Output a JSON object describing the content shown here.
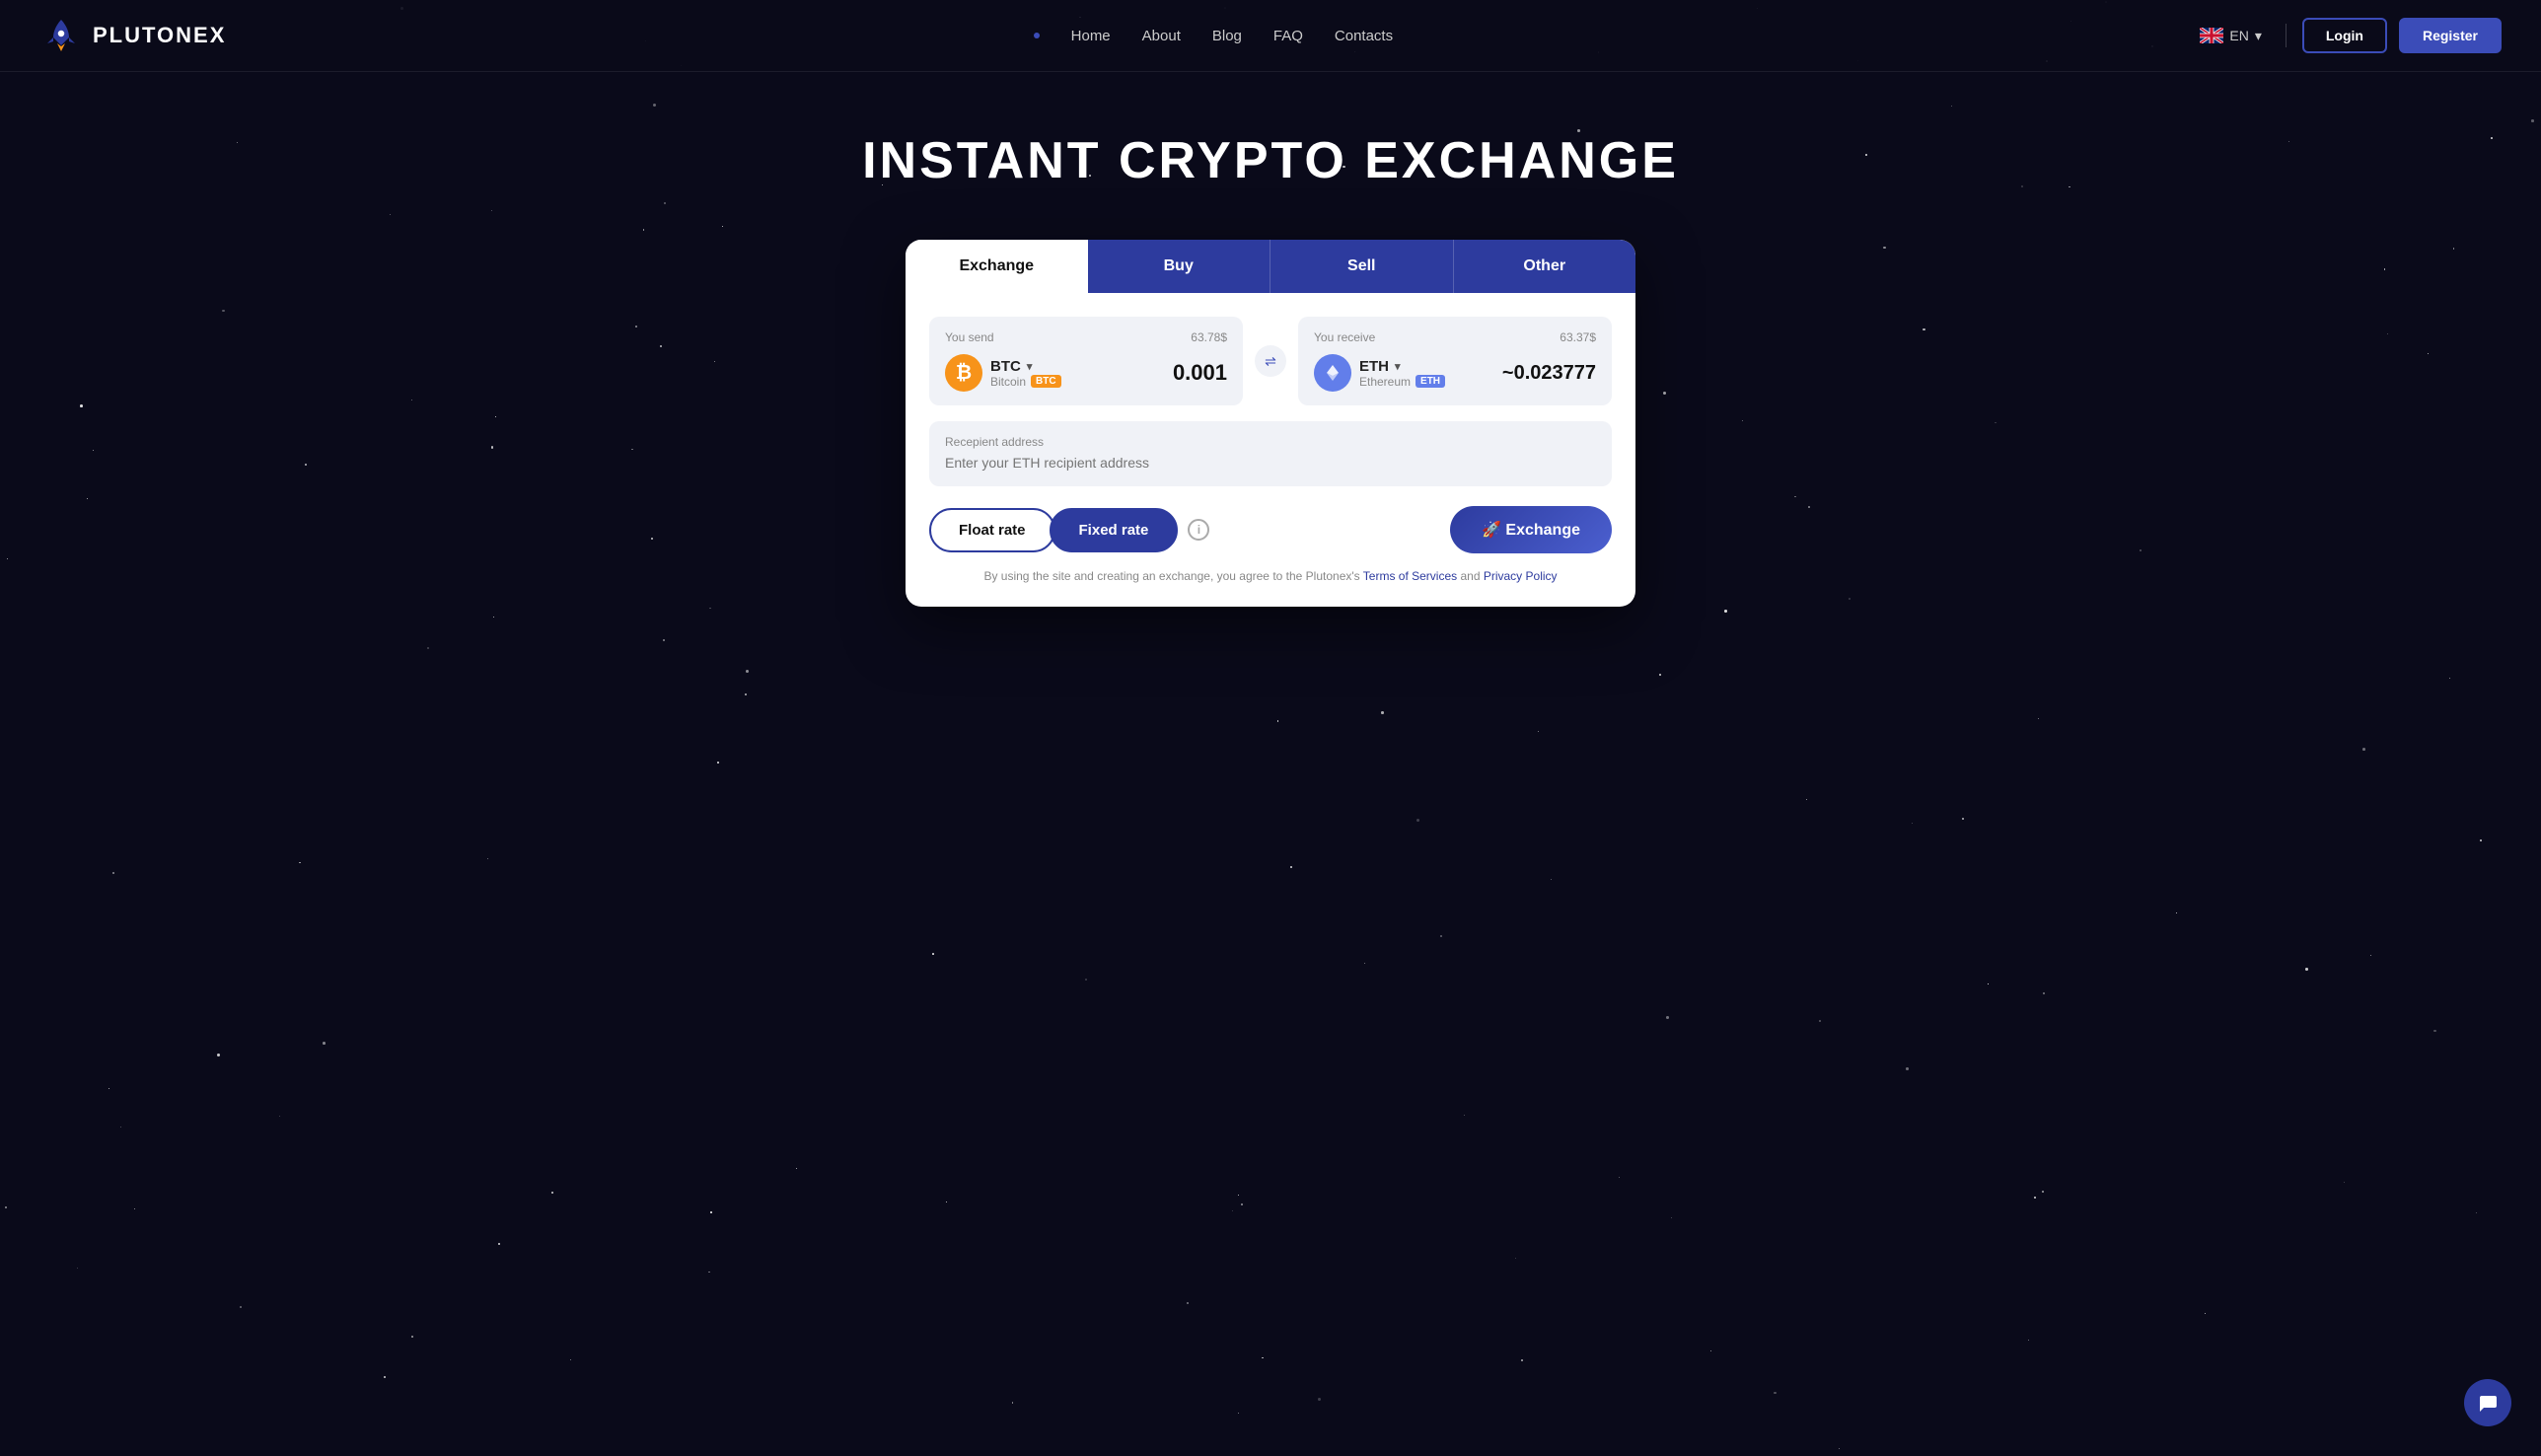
{
  "brand": {
    "name": "PLUTONEX",
    "logo_alt": "Plutonex rocket logo"
  },
  "nav": {
    "items": [
      {
        "label": "Home",
        "href": "#"
      },
      {
        "label": "About",
        "href": "#"
      },
      {
        "label": "Blog",
        "href": "#"
      },
      {
        "label": "FAQ",
        "href": "#"
      },
      {
        "label": "Contacts",
        "href": "#"
      }
    ],
    "language": "EN",
    "login_label": "Login",
    "register_label": "Register"
  },
  "hero": {
    "title": "INSTANT CRYPTO EXCHANGE"
  },
  "exchange_card": {
    "tabs": [
      {
        "label": "Exchange",
        "active": true
      },
      {
        "label": "Buy",
        "active": false
      },
      {
        "label": "Sell",
        "active": false
      },
      {
        "label": "Other",
        "active": false
      }
    ],
    "send": {
      "label": "You send",
      "usd_value": "63.78$",
      "currency_code": "BTC",
      "currency_full": "Bitcoin",
      "currency_badge": "BTC",
      "amount": "0.001"
    },
    "receive": {
      "label": "You receive",
      "usd_value": "63.37$",
      "currency_code": "ETH",
      "currency_full": "Ethereum",
      "currency_badge": "ETH",
      "amount": "~0.023777"
    },
    "recipient": {
      "label": "Recepient address",
      "placeholder": "Enter your ETH recipient address"
    },
    "rate_float_label": "Float rate",
    "rate_fixed_label": "Fixed rate",
    "exchange_btn_label": "🚀 Exchange",
    "terms_prefix": "By using the site and creating an exchange, you agree to the Plutonex's",
    "terms_of_service_label": "Terms of Services",
    "terms_and": "and",
    "privacy_policy_label": "Privacy Policy"
  }
}
